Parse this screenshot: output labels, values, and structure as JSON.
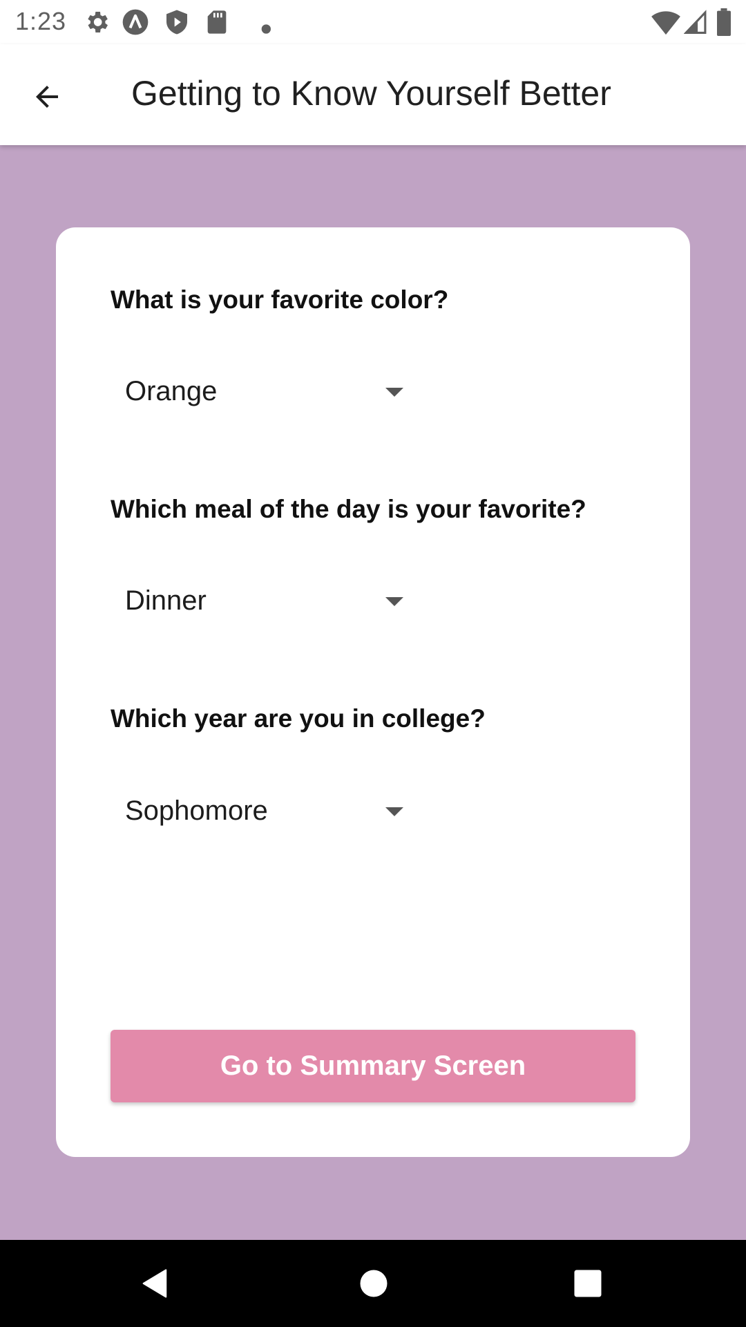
{
  "status_bar": {
    "time": "1:23",
    "icons": [
      "settings-gear-icon",
      "a-circle-icon",
      "play-shield-icon",
      "sd-card-icon",
      "dot-icon",
      "wifi-icon",
      "cell-signal-icon",
      "battery-icon"
    ]
  },
  "app_bar": {
    "back_icon": "arrow-back-icon",
    "title": "Getting to Know Yourself Better"
  },
  "colors": {
    "background": "#c0a3c4",
    "card": "#ffffff",
    "button": "#e38aaa",
    "button_text": "#ffffff"
  },
  "questions": [
    {
      "label": "What is your favorite color?",
      "selected": "Orange"
    },
    {
      "label": "Which meal of the day is your favorite?",
      "selected": "Dinner"
    },
    {
      "label": "Which year are you in college?",
      "selected": "Sophomore"
    }
  ],
  "primary_button": {
    "label": "Go to Summary Screen"
  },
  "nav_bar": {
    "buttons": [
      "nav-back-icon",
      "nav-home-icon",
      "nav-recents-icon"
    ]
  }
}
